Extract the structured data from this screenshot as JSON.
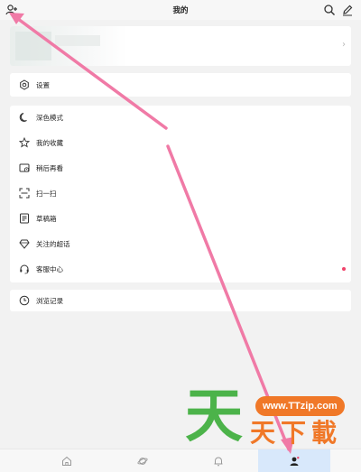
{
  "header": {
    "title": "我的"
  },
  "settings": {
    "label": "设置"
  },
  "menu": {
    "items": [
      {
        "label": "深色模式",
        "icon": "moon-icon"
      },
      {
        "label": "我的收藏",
        "icon": "star-icon"
      },
      {
        "label": "稍后再看",
        "icon": "watch-later-icon"
      },
      {
        "label": "扫一扫",
        "icon": "scan-icon"
      },
      {
        "label": "草稿箱",
        "icon": "drafts-icon"
      },
      {
        "label": "关注的超话",
        "icon": "diamond-icon"
      },
      {
        "label": "客服中心",
        "icon": "headset-icon"
      }
    ]
  },
  "history": {
    "label": "浏览记录"
  },
  "profile": {
    "chevron": "›"
  },
  "bottom_nav": {
    "items": [
      "home-icon",
      "planet-icon",
      "bell-icon",
      "profile-icon"
    ],
    "active": "profile-icon"
  },
  "watermark": {
    "big": "天",
    "site": "www.TTzip.com",
    "sub": "天下載"
  },
  "colors": {
    "accent_arrow": "#f07aa6",
    "badge_dot": "#f0436a",
    "active_tab": "#d8e8fb",
    "watermark_green": "#4cb34a",
    "watermark_orange": "#f07828"
  }
}
